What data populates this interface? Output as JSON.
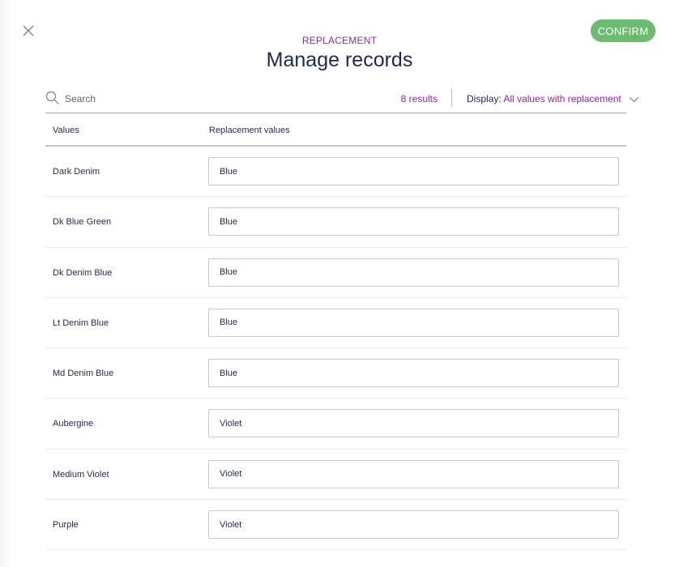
{
  "header": {
    "eyebrow": "REPLACEMENT",
    "title": "Manage records",
    "confirm_label": "CONFIRM"
  },
  "toolbar": {
    "search_placeholder": "Search",
    "results_text": "8 results",
    "display_label": "Display:",
    "display_value": "All values with replacement"
  },
  "table": {
    "columns": [
      "Values",
      "Replacement values"
    ],
    "rows": [
      {
        "value": "Dark Denim",
        "replacement": "Blue"
      },
      {
        "value": "Dk Blue Green",
        "replacement": "Blue"
      },
      {
        "value": "Dk Denim Blue",
        "replacement": "Blue"
      },
      {
        "value": "Lt Denim Blue",
        "replacement": "Blue"
      },
      {
        "value": "Md Denim Blue",
        "replacement": "Blue"
      },
      {
        "value": "Aubergine",
        "replacement": "Violet"
      },
      {
        "value": "Medium Violet",
        "replacement": "Violet"
      },
      {
        "value": "Purple",
        "replacement": "Violet"
      }
    ]
  },
  "colors": {
    "accent": "#8a2aa6",
    "confirm": "#6dbb72",
    "text": "#1d2a4a"
  },
  "icons": {
    "close": "close-icon",
    "search": "search-icon",
    "display": "chevron-down-icon"
  }
}
